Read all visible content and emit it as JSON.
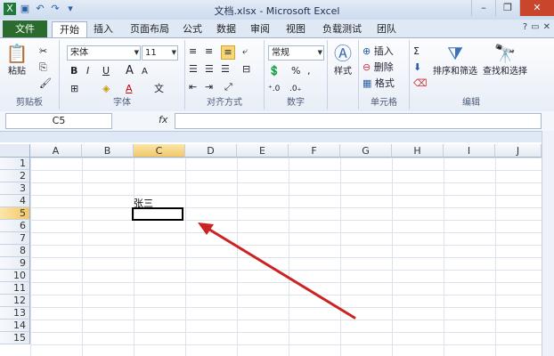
{
  "window": {
    "title": "文档.xlsx - Microsoft Excel"
  },
  "tabs": {
    "file": "文件",
    "items": [
      "开始",
      "插入",
      "页面布局",
      "公式",
      "数据",
      "审阅",
      "视图",
      "负载测试",
      "团队"
    ]
  },
  "clipboard": {
    "paste_label": "粘贴",
    "group_label": "剪贴板"
  },
  "font": {
    "name": "宋体",
    "size": "11",
    "group_label": "字体",
    "bold": "B",
    "italic": "I",
    "underline": "U",
    "grow": "A",
    "shrink": "A",
    "font_color": "A",
    "wen": "文"
  },
  "alignment": {
    "group_label": "对齐方式"
  },
  "number": {
    "format": "常规",
    "percent": "%",
    "comma": ",",
    "group_label": "数字"
  },
  "styles": {
    "label": "样式"
  },
  "cells": {
    "insert": "插入",
    "delete": "删除",
    "format": "格式",
    "group_label": "单元格"
  },
  "editing": {
    "sort_filter": "排序和筛选",
    "find_select": "查找和选择",
    "sigma": "Σ",
    "group_label": "编辑"
  },
  "formula_bar": {
    "name_box": "C5",
    "fx": "fx"
  },
  "sheet": {
    "columns": [
      "A",
      "B",
      "C",
      "D",
      "E",
      "F",
      "G",
      "H",
      "I",
      "J"
    ],
    "rows": [
      "1",
      "2",
      "3",
      "4",
      "5",
      "6",
      "7",
      "8",
      "9",
      "10",
      "11",
      "12",
      "13",
      "14",
      "15"
    ],
    "selected_cell": "C5",
    "cell_c4": "张三"
  },
  "accent": {
    "file_tab": "#2b6b2e",
    "arrow": "#cc2222",
    "selection": "#f2c76a"
  }
}
